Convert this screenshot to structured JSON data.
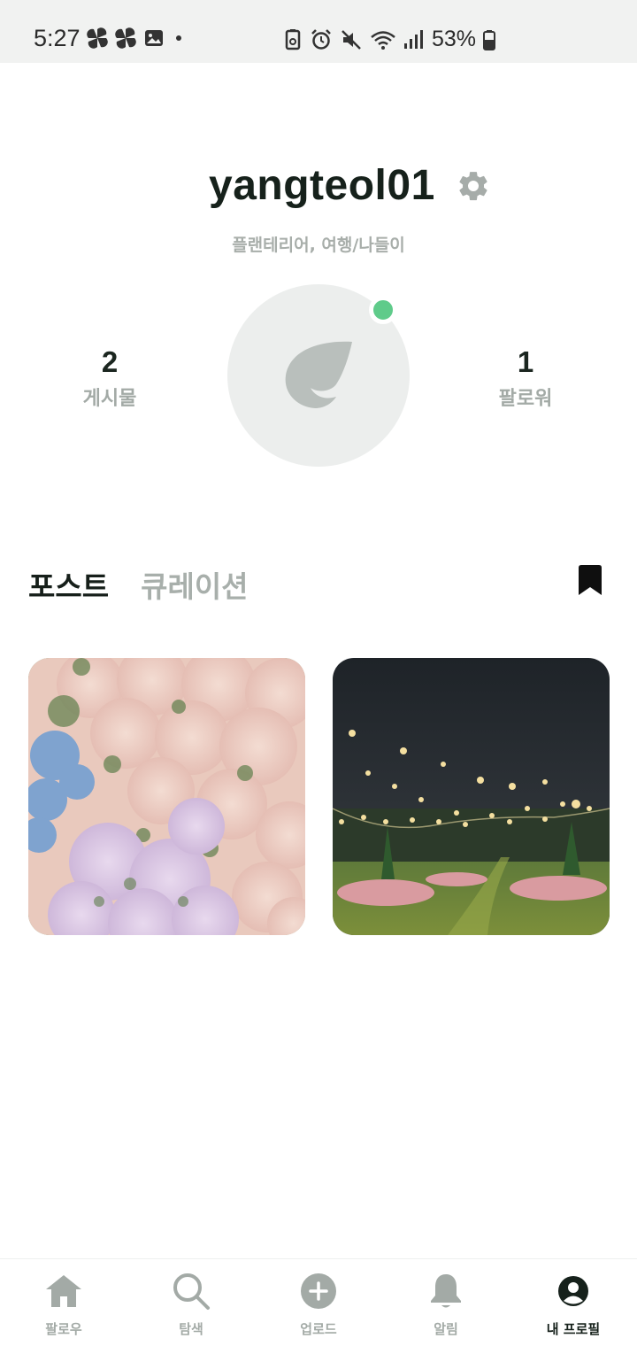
{
  "status_bar": {
    "time": "5:27",
    "battery": "53%",
    "left_icons": [
      "pinwheel-icon",
      "pinwheel-icon",
      "gallery-icon",
      "dot-icon"
    ],
    "right_icons": [
      "battery-saver-icon",
      "alarm-icon",
      "mute-icon",
      "wifi-icon",
      "signal-icon",
      "battery-icon"
    ]
  },
  "profile": {
    "username": "yangteol01",
    "bio": "플랜테리어, 여행/나들이",
    "posts_count": "2",
    "posts_label": "게시물",
    "followers_count": "1",
    "followers_label": "팔로워",
    "online_color": "#5fcb8a"
  },
  "tabs": {
    "posts": "포스트",
    "curation": "큐레이션"
  },
  "posts": [
    {
      "name": "flowers-photo"
    },
    {
      "name": "night-garden-photo"
    }
  ],
  "bottom_nav": {
    "items": [
      {
        "label": "팔로우",
        "icon": "home-icon"
      },
      {
        "label": "탐색",
        "icon": "search-icon"
      },
      {
        "label": "업로드",
        "icon": "plus-circle-icon"
      },
      {
        "label": "알림",
        "icon": "bell-icon"
      },
      {
        "label": "내 프로필",
        "icon": "profile-icon"
      }
    ],
    "active_index": 4
  },
  "colors": {
    "accent_dark": "#16211b",
    "muted": "#a8afab",
    "online": "#5fcb8a"
  }
}
